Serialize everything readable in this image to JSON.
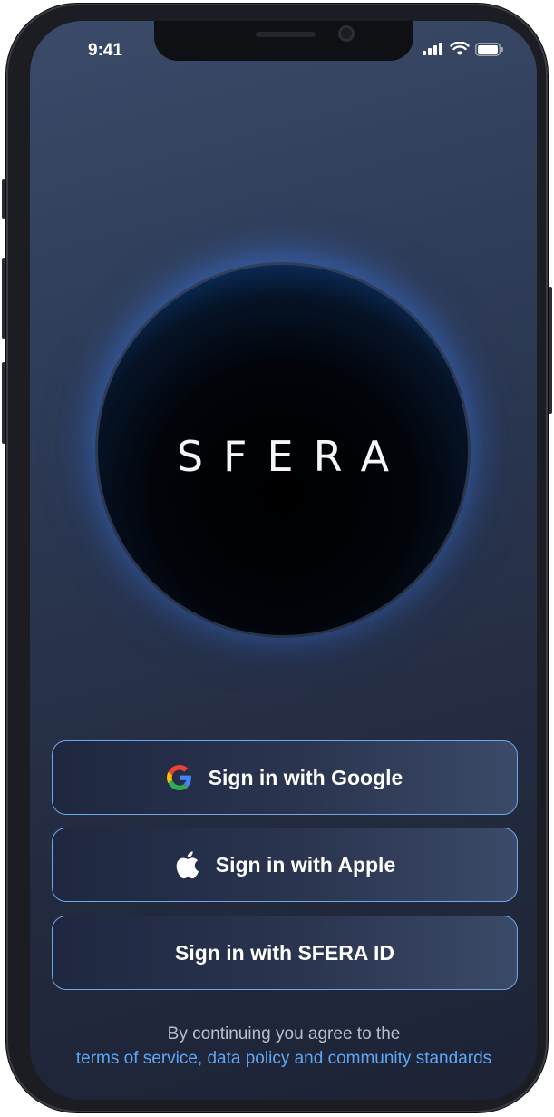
{
  "status_bar": {
    "time": "9:41"
  },
  "app": {
    "logo_text": "SFERA"
  },
  "buttons": {
    "google": {
      "label": "Sign in with Google",
      "icon": "google-icon"
    },
    "apple": {
      "label": "Sign in with Apple",
      "icon": "apple-icon"
    },
    "sfera": {
      "label": "Sign in with SFERA ID"
    }
  },
  "legal": {
    "prefix": "By continuing you agree to the",
    "link": "terms of service, data policy and community standards"
  },
  "colors": {
    "accent_link": "#5ea6f4",
    "button_border": "#6ea6e8",
    "background_top": "#3a4a68",
    "background_bottom": "#1d2335"
  }
}
